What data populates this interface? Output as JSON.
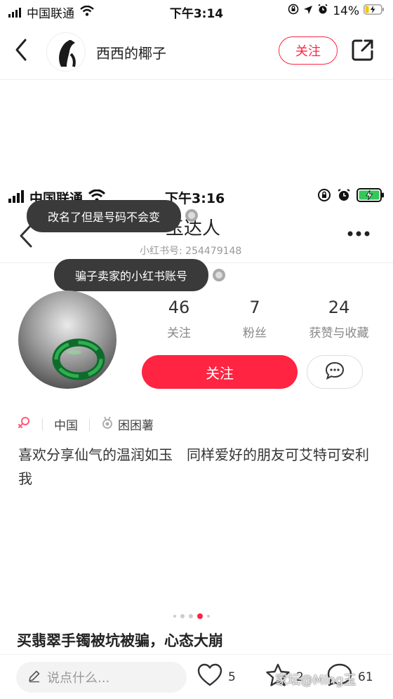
{
  "status_bar": {
    "carrier": "中国联通",
    "time": "下午3:14",
    "battery": "14%"
  },
  "nav": {
    "author": "西西的椰子",
    "follow_label": "关注"
  },
  "inner_status_bar": {
    "carrier": "中国联通",
    "time": "下午3:16"
  },
  "profile": {
    "name": "玉达人",
    "id_text": "小红书号: 254479148",
    "stats": [
      {
        "num": "46",
        "label": "关注"
      },
      {
        "num": "7",
        "label": "粉丝"
      },
      {
        "num": "24",
        "label": "获赞与收藏"
      }
    ],
    "follow_label": "关注",
    "tags": {
      "location": "中国",
      "school": "困困薯"
    },
    "bio": "喜欢分享仙气的温润如玉　同样爱好的朋友可艾特可安利我"
  },
  "tooltips": {
    "tip1": "改名了但是号码不会变",
    "tip2": "骗子卖家的小红书账号"
  },
  "post": {
    "title": "买翡翠手镯被坑被骗，心态大崩"
  },
  "carousel": {
    "count": 5,
    "active": 3
  },
  "bottom_bar": {
    "comment_placeholder": "说点什么...",
    "likes": "5",
    "collects": "2",
    "comments": "61"
  },
  "watermark": "家坛@Ming玉",
  "colors": {
    "accent": "#ff2442"
  }
}
